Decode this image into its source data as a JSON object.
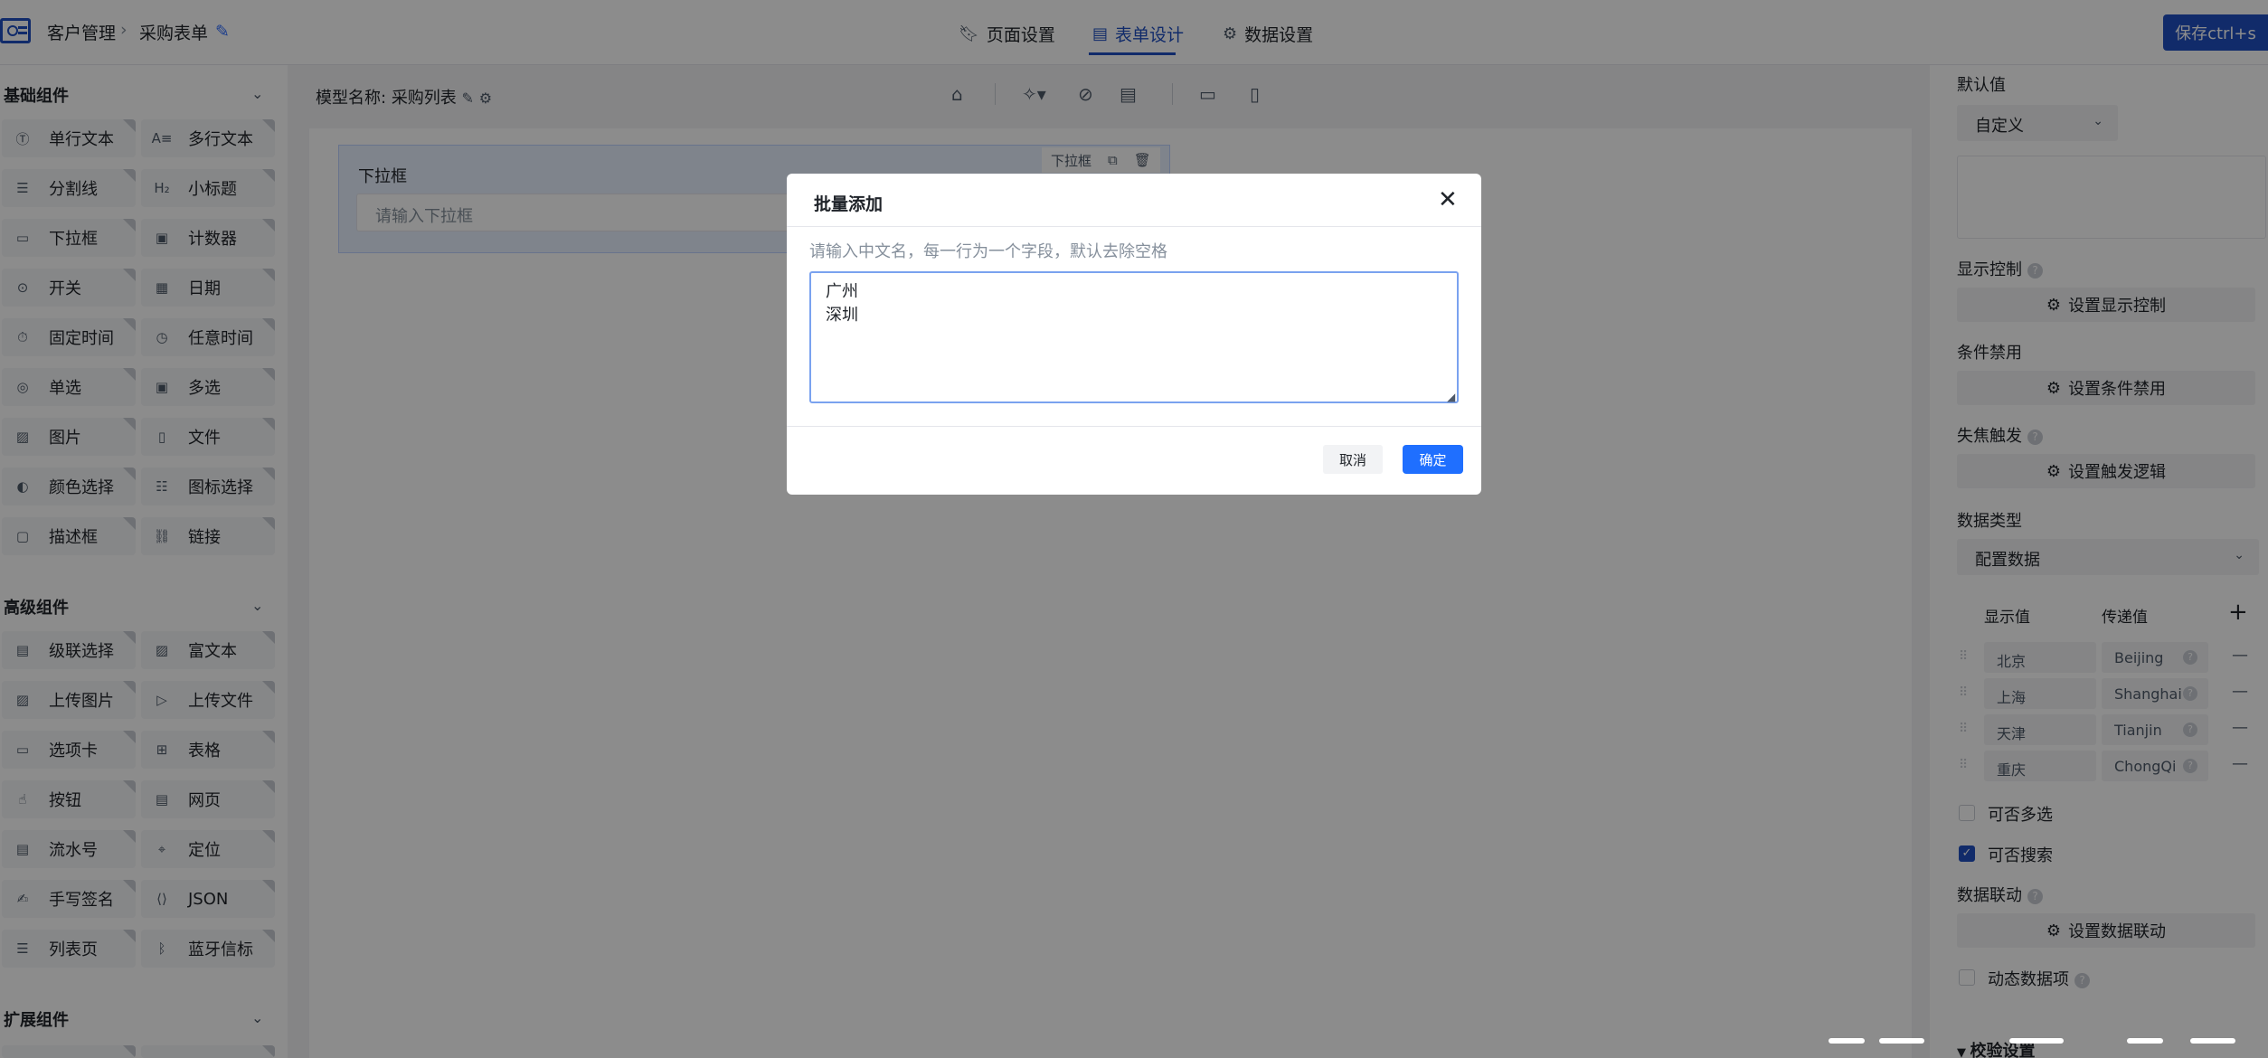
{
  "header": {
    "breadcrumb": [
      "客户管理",
      "采购表单"
    ],
    "tabs": [
      {
        "label": "页面设置",
        "icon": "bookmark-icon"
      },
      {
        "label": "表单设计",
        "icon": "document-icon",
        "active": true
      },
      {
        "label": "数据设置",
        "icon": "gear-icon"
      }
    ],
    "save_label": "保存ctrl+s"
  },
  "left": {
    "sections": [
      {
        "title": "基础组件",
        "items": [
          {
            "label": "单行文本",
            "icon": "text-icon"
          },
          {
            "label": "多行文本",
            "icon": "multiline-text-icon"
          },
          {
            "label": "分割线",
            "icon": "divider-icon"
          },
          {
            "label": "小标题",
            "icon": "heading-icon"
          },
          {
            "label": "下拉框",
            "icon": "dropdown-icon"
          },
          {
            "label": "计数器",
            "icon": "counter-icon"
          },
          {
            "label": "开关",
            "icon": "toggle-icon"
          },
          {
            "label": "日期",
            "icon": "calendar-icon"
          },
          {
            "label": "固定时间",
            "icon": "timer-icon"
          },
          {
            "label": "任意时间",
            "icon": "clock-icon"
          },
          {
            "label": "单选",
            "icon": "radio-icon"
          },
          {
            "label": "多选",
            "icon": "checkbox-icon"
          },
          {
            "label": "图片",
            "icon": "image-icon"
          },
          {
            "label": "文件",
            "icon": "file-icon"
          },
          {
            "label": "颜色选择",
            "icon": "palette-icon"
          },
          {
            "label": "图标选择",
            "icon": "icon-picker-icon"
          },
          {
            "label": "描述框",
            "icon": "description-icon"
          },
          {
            "label": "链接",
            "icon": "link-icon"
          }
        ]
      },
      {
        "title": "高级组件",
        "items": [
          {
            "label": "级联选择",
            "icon": "cascader-icon"
          },
          {
            "label": "富文本",
            "icon": "rich-text-icon"
          },
          {
            "label": "上传图片",
            "icon": "upload-image-icon"
          },
          {
            "label": "上传文件",
            "icon": "upload-file-icon"
          },
          {
            "label": "选项卡",
            "icon": "tabs-icon"
          },
          {
            "label": "表格",
            "icon": "table-icon"
          },
          {
            "label": "按钮",
            "icon": "button-icon"
          },
          {
            "label": "网页",
            "icon": "webpage-icon"
          },
          {
            "label": "流水号",
            "icon": "serial-number-icon"
          },
          {
            "label": "定位",
            "icon": "location-icon"
          },
          {
            "label": "手写签名",
            "icon": "signature-icon"
          },
          {
            "label": "JSON",
            "icon": "json-icon"
          },
          {
            "label": "列表页",
            "icon": "list-page-icon"
          },
          {
            "label": "蓝牙信标",
            "icon": "bluetooth-icon"
          }
        ]
      },
      {
        "title": "扩展组件",
        "items": []
      }
    ]
  },
  "canvas": {
    "model_label": "模型名称:",
    "model_name": "采购列表",
    "field": {
      "label": "下拉框",
      "placeholder": "请输入下拉框",
      "tag": "下拉框"
    }
  },
  "right": {
    "default_value_label": "默认值",
    "default_value_select": "自定义",
    "display_control_label": "显示控制",
    "display_control_btn": "设置显示控制",
    "disable_label": "条件禁用",
    "disable_btn": "设置条件禁用",
    "blur_label": "失焦触发",
    "blur_btn": "设置触发逻辑",
    "data_type_label": "数据类型",
    "data_type_select": "配置数据",
    "kv_headers": [
      "显示值",
      "传递值"
    ],
    "kv_rows": [
      {
        "display": "北京",
        "value": "Beijing"
      },
      {
        "display": "上海",
        "value": "Shanghai"
      },
      {
        "display": "天津",
        "value": "Tianjin"
      },
      {
        "display": "重庆",
        "value": "ChongQi"
      }
    ],
    "multi_select_label": "可否多选",
    "searchable_label": "可否搜索",
    "linkage_label": "数据联动",
    "linkage_btn": "设置数据联动",
    "dynamic_label": "动态数据项",
    "validation_label": "校验设置"
  },
  "dialog": {
    "title": "批量添加",
    "hint": "请输入中文名，每一行为一个字段，默认去除空格",
    "textarea_value": "广州\n深圳",
    "cancel_label": "取消",
    "ok_label": "确定"
  },
  "colors": {
    "accent": "#1f4fc2",
    "primary_button": "#1f6fff",
    "overlay": "rgba(0,0,0,0.45)"
  }
}
